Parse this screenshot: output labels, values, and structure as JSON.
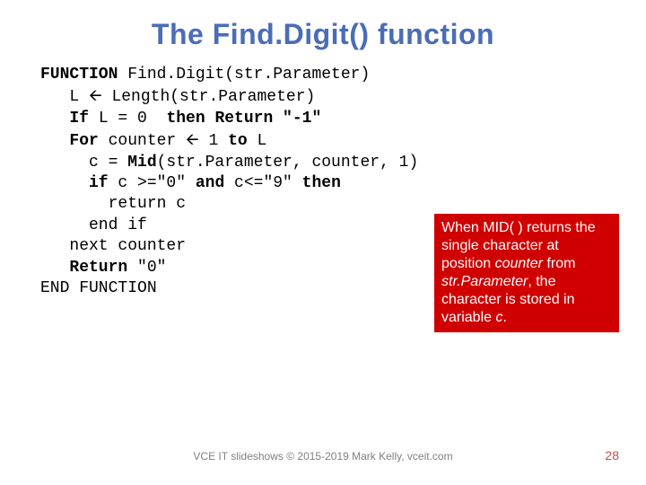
{
  "title": "The Find.Digit() function",
  "code": {
    "l1a": "FUNCTION",
    "l1b": " Find.Digit(str.Parameter)",
    "l2a": "   L ",
    "l2arrow": "🡨",
    "l2b": " Length(str.Parameter)",
    "l3a": "   If",
    "l3b": " L = 0  ",
    "l3c": "then Return \"-1\"",
    "l4a": "   For",
    "l4b": " counter ",
    "l4arrow": "🡨",
    "l4c": " 1 ",
    "l4d": "to",
    "l4e": " L",
    "l5a": "     c = ",
    "l5b": "Mid",
    "l5c": "(str.Parameter, counter, 1)",
    "l6a": "     if",
    "l6b": " c >=\"0\" ",
    "l6c": "and",
    "l6d": " c<=\"9\" ",
    "l6e": "then",
    "l7": "       return c",
    "l8": "     end if",
    "l9": "   next counter",
    "l10a": "   Return",
    "l10b": " \"0\"",
    "l11": "END FUNCTION"
  },
  "callout": {
    "t1": "When MID( ) returns the single character at position ",
    "t2": "counter",
    "t3": " from ",
    "t4": "str.Parameter",
    "t5": ", the character is stored in variable ",
    "t6": "c",
    "t7": "."
  },
  "footer": "VCE IT slideshows © 2015-2019 Mark Kelly, vceit.com",
  "page": "28"
}
